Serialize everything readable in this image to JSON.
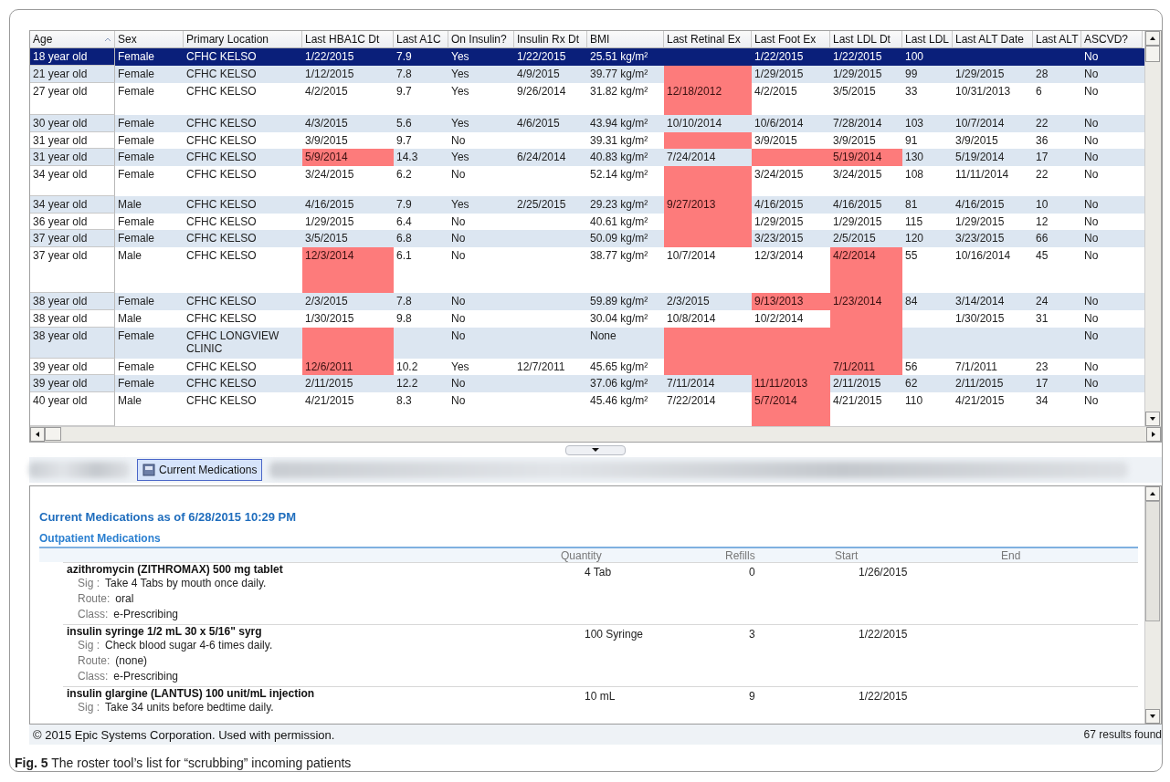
{
  "table": {
    "columns": [
      "Age",
      "Sex",
      "Primary Location",
      "Last HBA1C Dt",
      "Last A1C",
      "On Insulin?",
      "Insulin Rx Dt",
      "BMI",
      "Last Retinal Ex",
      "Last Foot Ex",
      "Last LDL Dt",
      "Last LDL",
      "Last ALT Date",
      "Last ALT",
      "ASCVD?"
    ],
    "rows": [
      {
        "selected": true,
        "cells": [
          "18 year old",
          "Female",
          "CFHC KELSO",
          "1/22/2015",
          "7.9",
          "Yes",
          "1/22/2015",
          "25.51 kg/m²",
          null,
          "1/22/2015",
          "1/22/2015",
          "100",
          null,
          null,
          "No"
        ],
        "flagged": [
          false,
          false,
          false,
          false,
          false,
          false,
          false,
          false,
          false,
          false,
          false,
          false,
          false,
          false,
          false
        ]
      },
      {
        "selected": false,
        "cells": [
          "21 year old",
          "Female",
          "CFHC KELSO",
          "1/12/2015",
          "7.8",
          "Yes",
          "4/9/2015",
          "39.77 kg/m²",
          null,
          "1/29/2015",
          "1/29/2015",
          "99",
          "1/29/2015",
          "28",
          "No"
        ],
        "flagged": [
          false,
          false,
          false,
          false,
          false,
          false,
          false,
          false,
          true,
          false,
          false,
          false,
          false,
          false,
          false
        ]
      },
      {
        "selected": false,
        "cells": [
          "27 year old",
          "Female",
          "CFHC KELSO",
          "4/2/2015",
          "9.7",
          "Yes",
          "9/26/2014",
          "31.82 kg/m²",
          "12/18/2012",
          "4/2/2015",
          "3/5/2015",
          "33",
          "10/31/2013",
          "6",
          "No"
        ],
        "flagged": [
          false,
          false,
          false,
          false,
          false,
          false,
          false,
          false,
          true,
          false,
          false,
          false,
          false,
          false,
          false
        ]
      },
      {
        "selected": false,
        "cells": [
          "30 year old",
          "Female",
          "CFHC KELSO",
          "4/3/2015",
          "5.6",
          "Yes",
          "4/6/2015",
          "43.94 kg/m²",
          "10/10/2014",
          "10/6/2014",
          "7/28/2014",
          "103",
          "10/7/2014",
          "22",
          "No"
        ],
        "flagged": [
          false,
          false,
          false,
          false,
          false,
          false,
          false,
          false,
          false,
          false,
          false,
          false,
          false,
          false,
          false
        ]
      },
      {
        "selected": false,
        "cells": [
          "31 year old",
          "Female",
          "CFHC KELSO",
          "3/9/2015",
          "9.7",
          "No",
          null,
          "39.31 kg/m²",
          null,
          "3/9/2015",
          "3/9/2015",
          "91",
          "3/9/2015",
          "36",
          "No"
        ],
        "flagged": [
          false,
          false,
          false,
          false,
          false,
          false,
          false,
          false,
          true,
          false,
          false,
          false,
          false,
          false,
          false
        ]
      },
      {
        "selected": false,
        "cells": [
          "31 year old",
          "Female",
          "CFHC KELSO",
          "5/9/2014",
          "14.3",
          "Yes",
          "6/24/2014",
          "40.83 kg/m²",
          "7/24/2014",
          null,
          "5/19/2014",
          "130",
          "5/19/2014",
          "17",
          "No"
        ],
        "flagged": [
          false,
          false,
          false,
          true,
          false,
          false,
          false,
          false,
          false,
          true,
          true,
          false,
          false,
          false,
          false
        ]
      },
      {
        "selected": false,
        "cells": [
          "34 year old",
          "Female",
          "CFHC KELSO",
          "3/24/2015",
          "6.2",
          "No",
          null,
          "52.14 kg/m²",
          null,
          "3/24/2015",
          "3/24/2015",
          "108",
          "11/11/2014",
          "22",
          "No"
        ],
        "flagged": [
          false,
          false,
          false,
          false,
          false,
          false,
          false,
          false,
          true,
          false,
          false,
          false,
          false,
          false,
          false
        ]
      },
      {
        "selected": false,
        "cells": [
          "34 year old",
          "Male",
          "CFHC KELSO",
          "4/16/2015",
          "7.9",
          "Yes",
          "2/25/2015",
          "29.23 kg/m²",
          "9/27/2013",
          "4/16/2015",
          "4/16/2015",
          "81",
          "4/16/2015",
          "10",
          "No"
        ],
        "flagged": [
          false,
          false,
          false,
          false,
          false,
          false,
          false,
          false,
          true,
          false,
          false,
          false,
          false,
          false,
          false
        ]
      },
      {
        "selected": false,
        "cells": [
          "36 year old",
          "Female",
          "CFHC KELSO",
          "1/29/2015",
          "6.4",
          "No",
          null,
          "40.61 kg/m²",
          null,
          "1/29/2015",
          "1/29/2015",
          "115",
          "1/29/2015",
          "12",
          "No"
        ],
        "flagged": [
          false,
          false,
          false,
          false,
          false,
          false,
          false,
          false,
          true,
          false,
          false,
          false,
          false,
          false,
          false
        ]
      },
      {
        "selected": false,
        "cells": [
          "37 year old",
          "Female",
          "CFHC KELSO",
          "3/5/2015",
          "6.8",
          "No",
          null,
          "50.09 kg/m²",
          null,
          "3/23/2015",
          "2/5/2015",
          "120",
          "3/23/2015",
          "66",
          "No"
        ],
        "flagged": [
          false,
          false,
          false,
          false,
          false,
          false,
          false,
          false,
          true,
          false,
          false,
          false,
          false,
          false,
          false
        ]
      },
      {
        "selected": false,
        "cells": [
          "37 year old",
          "Male",
          "CFHC KELSO",
          "12/3/2014",
          "6.1",
          "No",
          null,
          "38.77 kg/m²",
          "10/7/2014",
          "12/3/2014",
          "4/2/2014",
          "55",
          "10/16/2014",
          "45",
          "No"
        ],
        "flagged": [
          false,
          false,
          false,
          true,
          false,
          false,
          false,
          false,
          false,
          false,
          true,
          false,
          false,
          false,
          false
        ]
      },
      {
        "selected": false,
        "cells": [
          "38 year old",
          "Female",
          "CFHC KELSO",
          "2/3/2015",
          "7.8",
          "No",
          null,
          "59.89 kg/m²",
          "2/3/2015",
          "9/13/2013",
          "1/23/2014",
          "84",
          "3/14/2014",
          "24",
          "No"
        ],
        "flagged": [
          false,
          false,
          false,
          false,
          false,
          false,
          false,
          false,
          false,
          true,
          true,
          false,
          false,
          false,
          false
        ]
      },
      {
        "selected": false,
        "cells": [
          "38 year old",
          "Male",
          "CFHC KELSO",
          "1/30/2015",
          "9.8",
          "No",
          null,
          "30.04 kg/m²",
          "10/8/2014",
          "10/2/2014",
          null,
          null,
          "1/30/2015",
          "31",
          "No"
        ],
        "flagged": [
          false,
          false,
          false,
          false,
          false,
          false,
          false,
          false,
          false,
          false,
          true,
          false,
          false,
          false,
          false
        ]
      },
      {
        "selected": false,
        "cells": [
          "38 year old",
          "Female",
          "CFHC LONGVIEW CLINIC",
          null,
          null,
          "No",
          null,
          "None",
          null,
          null,
          null,
          null,
          null,
          null,
          "No"
        ],
        "flagged": [
          false,
          false,
          false,
          true,
          false,
          false,
          false,
          false,
          true,
          true,
          true,
          false,
          false,
          false,
          false
        ]
      },
      {
        "selected": false,
        "cells": [
          "39 year old",
          "Female",
          "CFHC KELSO",
          "12/6/2011",
          "10.2",
          "Yes",
          "12/7/2011",
          "45.65 kg/m²",
          null,
          null,
          "7/1/2011",
          "56",
          "7/1/2011",
          "23",
          "No"
        ],
        "flagged": [
          false,
          false,
          false,
          true,
          false,
          false,
          false,
          false,
          true,
          true,
          true,
          false,
          false,
          false,
          false
        ]
      },
      {
        "selected": false,
        "cells": [
          "39 year old",
          "Female",
          "CFHC KELSO",
          "2/11/2015",
          "12.2",
          "No",
          null,
          "37.06 kg/m²",
          "7/11/2014",
          "11/11/2013",
          "2/11/2015",
          "62",
          "2/11/2015",
          "17",
          "No"
        ],
        "flagged": [
          false,
          false,
          false,
          false,
          false,
          false,
          false,
          false,
          false,
          true,
          false,
          false,
          false,
          false,
          false
        ]
      },
      {
        "selected": false,
        "cells": [
          "40 year old",
          "Male",
          "CFHC KELSO",
          "4/21/2015",
          "8.3",
          "No",
          null,
          "45.46 kg/m²",
          "7/22/2014",
          "5/7/2014",
          "4/21/2015",
          "110",
          "4/21/2015",
          "34",
          "No"
        ],
        "flagged": [
          false,
          false,
          false,
          false,
          false,
          false,
          false,
          false,
          false,
          true,
          false,
          false,
          false,
          false,
          false
        ]
      }
    ]
  },
  "tabs": [
    {
      "label": "Current Medications",
      "selected": true
    }
  ],
  "medications_panel": {
    "title": "Current Medications as of 6/28/2015 10:29 PM",
    "section": "Outpatient Medications",
    "columns": [
      "Quantity",
      "Refills",
      "Start",
      "End"
    ],
    "medications": [
      {
        "name": "azithromycin (ZITHROMAX) 500 mg tablet",
        "quantity": "4 Tab",
        "refills": "0",
        "start": "1/26/2015",
        "details": [
          {
            "label": "Sig :",
            "value": "Take 4 Tabs by mouth once daily."
          },
          {
            "label": "Route:",
            "value": "oral"
          },
          {
            "label": "Class:",
            "value": "e-Prescribing"
          }
        ]
      },
      {
        "name": "insulin syringe 1/2 mL 30 x 5/16\" syrg",
        "quantity": "100 Syringe",
        "refills": "3",
        "start": "1/22/2015",
        "details": [
          {
            "label": "Sig :",
            "value": "Check blood sugar 4-6 times daily."
          },
          {
            "label": "Route:",
            "value": "(none)"
          },
          {
            "label": "Class:",
            "value": "e-Prescribing"
          }
        ]
      },
      {
        "name": "insulin glargine (LANTUS) 100 unit/mL injection",
        "quantity": "10 mL",
        "refills": "9",
        "start": "1/22/2015",
        "details": [
          {
            "label": "Sig :",
            "value": "Take 34 units before bedtime daily."
          }
        ]
      }
    ]
  },
  "footer": {
    "copyright": "© 2015 Epic Systems Corporation. Used with permission.",
    "results": "67 results found"
  },
  "caption": "**Fig. 5** The roster tool’s list for “scrubbing” incoming patients"
}
